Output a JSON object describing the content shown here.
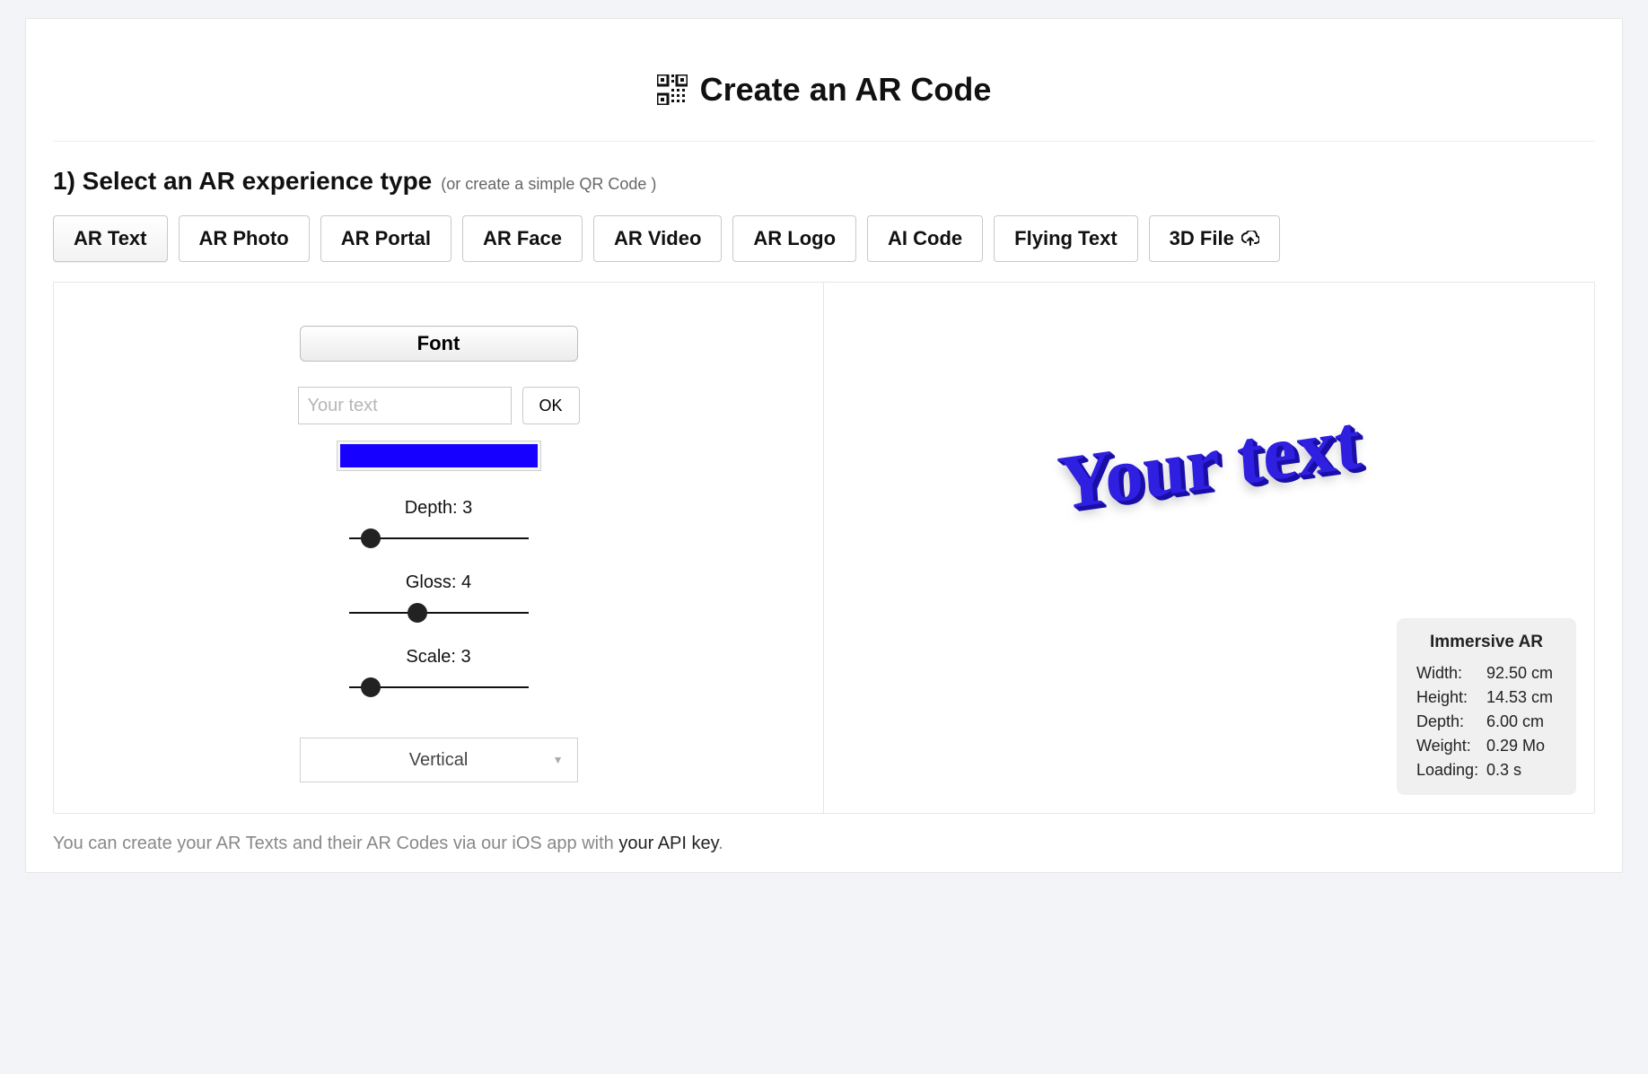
{
  "header": {
    "title": "Create an AR Code"
  },
  "step1": {
    "heading": "1) Select an AR experience type",
    "sub_prefix": "(or create a ",
    "sub_link": "simple QR Code",
    "sub_suffix": " )"
  },
  "tabs": {
    "ar_text": "AR Text",
    "ar_photo": "AR Photo",
    "ar_portal": "AR Portal",
    "ar_face": "AR Face",
    "ar_video": "AR Video",
    "ar_logo": "AR Logo",
    "ai_code": "AI Code",
    "flying_text": "Flying Text",
    "file_3d": "3D File"
  },
  "controls": {
    "font_button": "Font",
    "text_placeholder": "Your text",
    "text_value": "",
    "ok_label": "OK",
    "color_hex": "#1600ff",
    "depth_label": "Depth: 3",
    "depth_pct": 12,
    "gloss_label": "Gloss: 4",
    "gloss_pct": 38,
    "scale_label": "Scale: 3",
    "scale_pct": 12,
    "orientation_selected": "Vertical"
  },
  "preview": {
    "text": "Your text"
  },
  "stats": {
    "title": "Immersive AR",
    "rows": {
      "width": {
        "k": "Width:",
        "v": "92.50  cm"
      },
      "height": {
        "k": "Height:",
        "v": " 14.53  cm"
      },
      "depth": {
        "k": "Depth:",
        "v": "6.00  cm"
      },
      "weight": {
        "k": "Weight:",
        "v": " 0.29 Mo"
      },
      "loading": {
        "k": "Loading:",
        "v": "0.3 s"
      }
    }
  },
  "footer": {
    "pre": "You can create your AR Texts and their AR Codes via our iOS app with ",
    "link": "your API key",
    "post": "."
  }
}
